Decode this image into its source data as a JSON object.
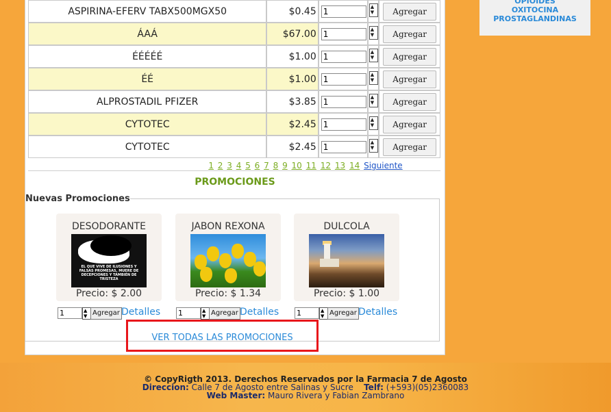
{
  "sidebar": {
    "categories": [
      "OPIOIDES",
      "OXITOCINA",
      "PROSTAGLANDINAS"
    ]
  },
  "products": {
    "add_label": "Agregar",
    "rows": [
      {
        "name": "ASPIRINA-EFERV TABX500MGX50",
        "price": "$0.45",
        "qty": "1"
      },
      {
        "name": "ÁAÁ",
        "price": "$67.00",
        "qty": "1"
      },
      {
        "name": "ÉÉÉÉÉ",
        "price": "$1.00",
        "qty": "1"
      },
      {
        "name": "ÉÉ",
        "price": "$1.00",
        "qty": "1"
      },
      {
        "name": "ALPROSTADIL PFIZER",
        "price": "$3.85",
        "qty": "1"
      },
      {
        "name": "CYTOTEC",
        "price": "$2.45",
        "qty": "1"
      },
      {
        "name": "CYTOTEC",
        "price": "$2.45",
        "qty": "1"
      }
    ]
  },
  "pager": {
    "pages": [
      "1",
      "2",
      "3",
      "4",
      "5",
      "6",
      "7",
      "8",
      "9",
      "10",
      "11",
      "12",
      "13",
      "14"
    ],
    "next_label": "Siguiente"
  },
  "promos": {
    "title": "PROMOCIONES",
    "legend": "Nuevas Promociones",
    "image_caption": "EL QUE VIVE DE ILUSIONES Y FALSAS PROMESAS, MUERE DE DECEPCIONES Y TAMBIÉN DE TRISTEZA",
    "cards": [
      {
        "title": "DESODORANTE",
        "price": "Precio: $ 2.00",
        "qty": "1",
        "add_label": "Agregar",
        "details_label": "Detalles"
      },
      {
        "title": "JABON REXONA",
        "price": "Precio: $ 1.34",
        "qty": "1",
        "add_label": "Agregar",
        "details_label": "Detalles"
      },
      {
        "title": "DULCOLA",
        "price": "Precio: $ 1.00",
        "qty": "1",
        "add_label": "Agregar",
        "details_label": "Detalles"
      }
    ],
    "see_all": "VER TODAS LAS PROMOCIONES"
  },
  "footer": {
    "copyright": "© CopyRigth 2013. Derechos Reservados por la Farmacia 7 de Agosto",
    "address_label": "Direccion:",
    "address": "Calle 7 de Agosto entre Salinas y Sucre",
    "phone_label": "Telf:",
    "phone": "(+593)(05)2360083",
    "webmaster_label": "Web Master:",
    "webmaster": "Mauro Rivera y Fabian Zambrano"
  },
  "colors": {
    "accent_link": "#2a8ad8",
    "pager_link": "#7cad22",
    "promo_title": "#6b9a1a",
    "highlight_box": "#e8161b",
    "alt_row": "#fbf8c8"
  }
}
